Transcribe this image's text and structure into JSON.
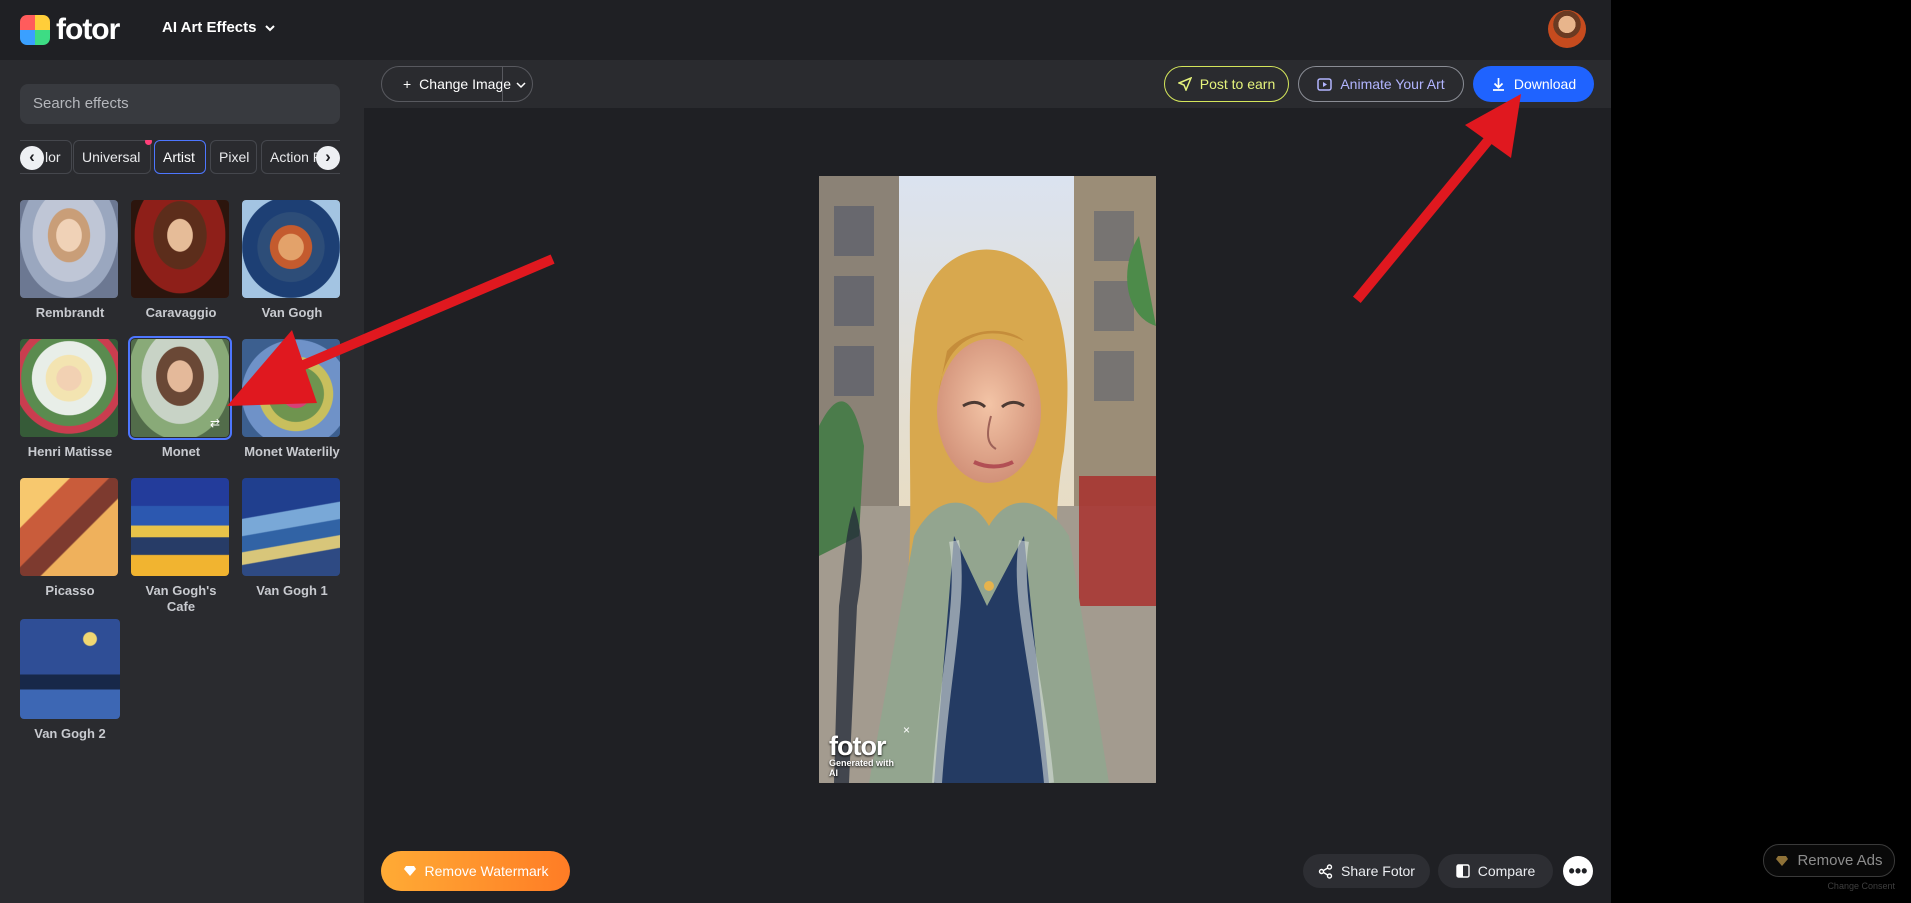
{
  "app": {
    "logo_text": "fotor",
    "menu_title": "AI Art Effects"
  },
  "sidebar": {
    "search_placeholder": "Search effects",
    "tabs": [
      {
        "label": "lor"
      },
      {
        "label": "Universal"
      },
      {
        "label": "Artist",
        "active": true
      },
      {
        "label": "Pixel"
      },
      {
        "label": "Action F"
      }
    ],
    "effects": [
      {
        "name": "Rembrandt"
      },
      {
        "name": "Caravaggio"
      },
      {
        "name": "Van Gogh"
      },
      {
        "name": "Henri Matisse"
      },
      {
        "name": "Monet",
        "selected": true
      },
      {
        "name": "Monet Waterlily"
      },
      {
        "name": "Picasso"
      },
      {
        "name": "Van Gogh's Cafe"
      },
      {
        "name": "Van Gogh 1"
      },
      {
        "name": "Van Gogh 2"
      }
    ]
  },
  "toolbar": {
    "change_image": "Change Image",
    "post_to_earn": "Post to earn",
    "animate_your_art": "Animate Your Art",
    "download": "Download"
  },
  "canvas": {
    "watermark_logo": "fotor",
    "watermark_subtext": "Generated with AI"
  },
  "footer": {
    "remove_watermark": "Remove Watermark",
    "share": "Share Fotor",
    "compare": "Compare"
  },
  "ads": {
    "remove_ads": "Remove Ads",
    "change_consent": "Change Consent"
  },
  "colors": {
    "accent_blue": "#1f63ff",
    "post_earn": "#d4e65b",
    "remove_watermark": "#ff8f2d",
    "annotation_arrow": "#e0181f"
  },
  "icons": {
    "menu": "chevron-down-icon",
    "tabs_left": "chevron-left-icon",
    "tabs_right": "chevron-right-icon",
    "download": "download-icon",
    "share": "share-icon",
    "compare": "compare-icon",
    "more": "more-icon"
  }
}
